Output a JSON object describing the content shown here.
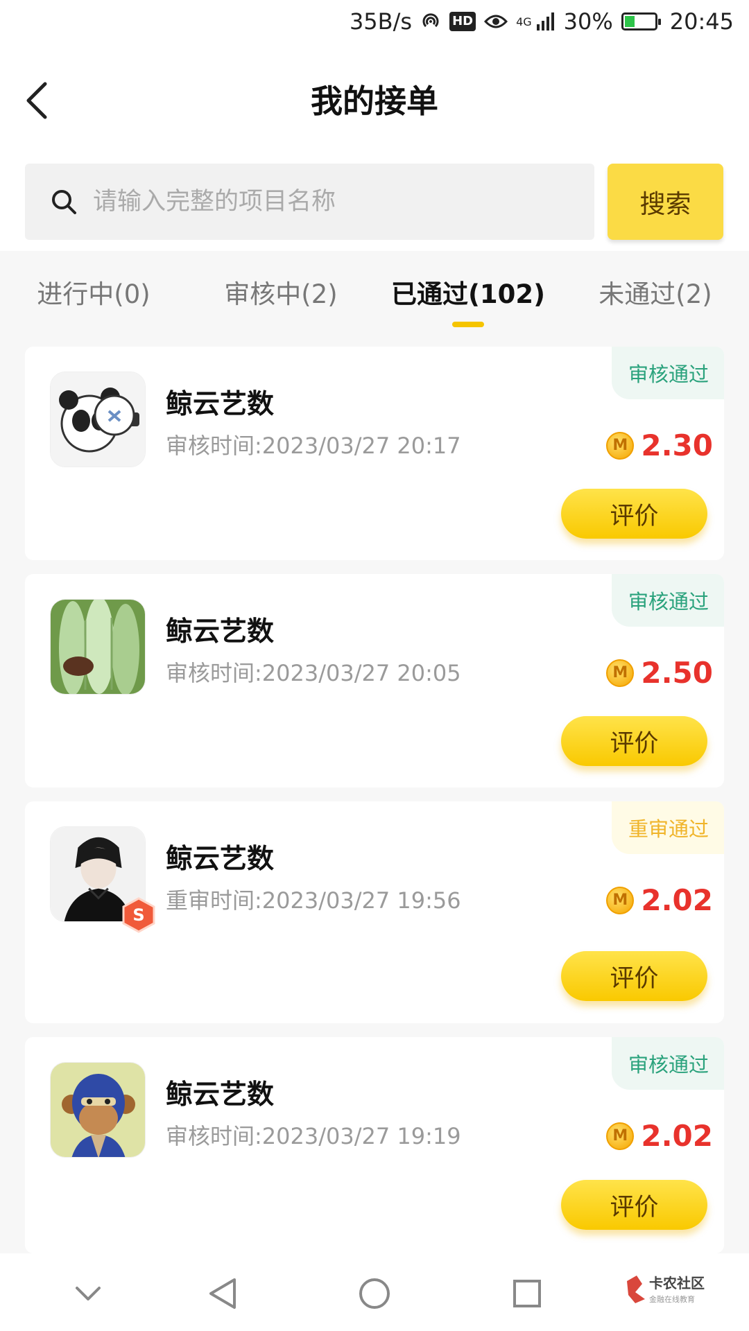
{
  "status_bar": {
    "speed": "35B/s",
    "hd": "HD",
    "network": "4G",
    "battery": "30%",
    "time": "20:45"
  },
  "header": {
    "title": "我的接单"
  },
  "search": {
    "placeholder": "请输入完整的项目名称",
    "button": "搜索"
  },
  "tabs": [
    {
      "label": "进行中(0)"
    },
    {
      "label": "审核中(2)"
    },
    {
      "label": "已通过(102)"
    },
    {
      "label": "未通过(2)"
    }
  ],
  "active_tab": 2,
  "orders": [
    {
      "name": "鲸云艺数",
      "time": "审核时间:2023/03/27 20:17",
      "status": "审核通过",
      "price": "2.30",
      "action": "评价"
    },
    {
      "name": "鲸云艺数",
      "time": "审核时间:2023/03/27 20:05",
      "status": "审核通过",
      "price": "2.50",
      "action": "评价"
    },
    {
      "name": "鲸云艺数",
      "time": "重审时间:2023/03/27 19:56",
      "status": "重审通过",
      "price": "2.02",
      "action": "评价"
    },
    {
      "name": "鲸云艺数",
      "time": "审核时间:2023/03/27 19:19",
      "status": "审核通过",
      "price": "2.02",
      "action": "评价"
    }
  ],
  "coin_symbol": "M",
  "watermark": {
    "main": "卡农社区",
    "sub": "金融在线教育"
  },
  "colors": {
    "accent": "#fbdb45",
    "price": "#e8322c",
    "pass": "#2aa27c",
    "repass": "#f0b429"
  }
}
